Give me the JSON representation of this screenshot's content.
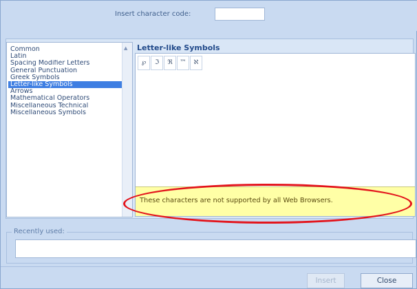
{
  "header": {
    "code_label": "Insert character code:",
    "code_value": ""
  },
  "categories": {
    "items": [
      {
        "label": "Common",
        "selected": false
      },
      {
        "label": "Latin",
        "selected": false
      },
      {
        "label": "Spacing Modifier Letters",
        "selected": false
      },
      {
        "label": "General Punctuation",
        "selected": false
      },
      {
        "label": "Greek Symbols",
        "selected": false
      },
      {
        "label": "Letter-like Symbols",
        "selected": true
      },
      {
        "label": "Arrows",
        "selected": false
      },
      {
        "label": "Mathematical Operators",
        "selected": false
      },
      {
        "label": "Miscellaneous Technical",
        "selected": false
      },
      {
        "label": "Miscellaneous Symbols",
        "selected": false
      }
    ]
  },
  "symbols": {
    "title": "Letter-like Symbols",
    "cells": [
      "℘",
      "ℑ",
      "ℜ",
      "™",
      "ℵ"
    ],
    "warning": "These characters are not supported by all Web Browsers."
  },
  "recent": {
    "legend": "Recently used:"
  },
  "buttons": {
    "insert": "Insert",
    "close": "Close"
  },
  "colors": {
    "background": "#c9daf1",
    "selection": "#3e7ee2",
    "warning_bg": "#ffffa6",
    "highlight": "#e3141c"
  }
}
